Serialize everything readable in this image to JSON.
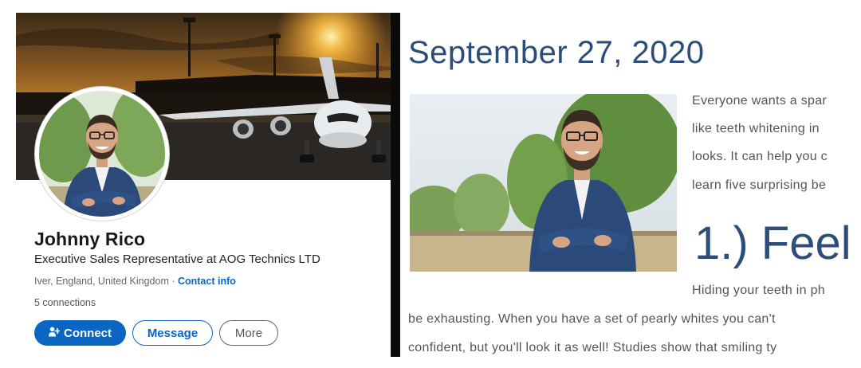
{
  "profile": {
    "name": "Johnny Rico",
    "headline": "Executive Sales Representative at AOG Technics LTD",
    "location": "Iver, England, United Kingdom",
    "separator": " · ",
    "contact_link": "Contact info",
    "connections": "5 connections",
    "buttons": {
      "connect": "Connect",
      "message": "Message",
      "more": "More"
    },
    "connect_icon": "add-person-icon"
  },
  "article": {
    "date": "September 27, 2020",
    "lines_beside_photo": [
      "Everyone wants a spar",
      "like teeth whitening in",
      "looks. It can help you c",
      "learn five surprising be"
    ],
    "heading": "1.) Feel",
    "line_after_heading": "Hiding your teeth in ph",
    "body_lines": [
      "be exhausting. When you have a set of pearly whites you can't",
      "confident, but you'll look it as well! Studies show that smiling ty"
    ]
  },
  "colors": {
    "linkedin_blue": "#0a66c2",
    "article_heading": "#2d4d79",
    "divider": "#0b0b0b"
  }
}
